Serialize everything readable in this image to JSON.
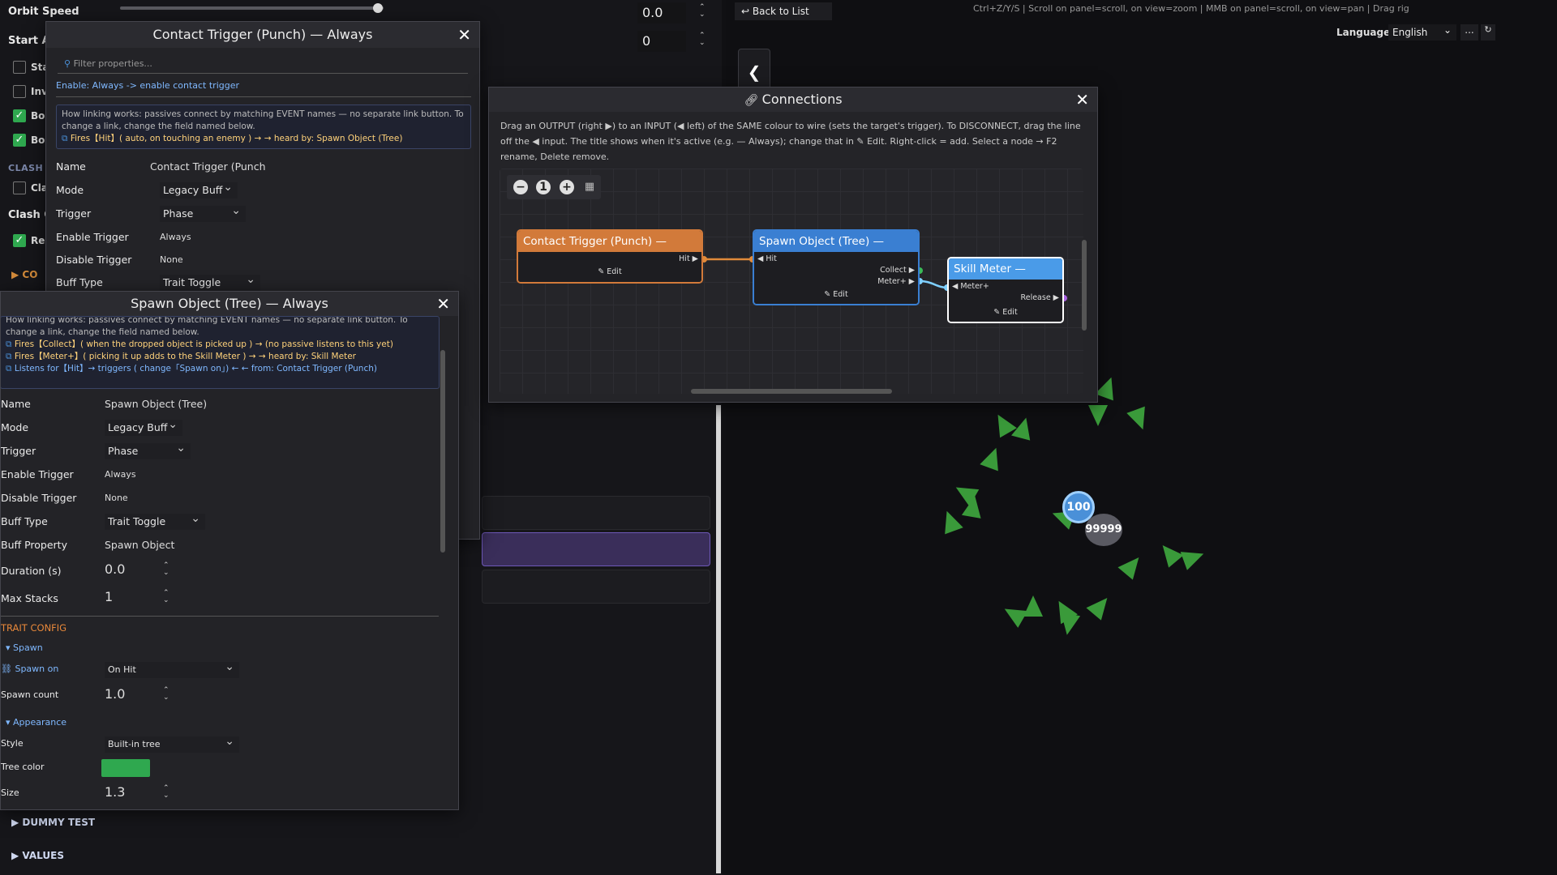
{
  "background": {
    "orbit_speed_label": "Orbit Speed",
    "orbit_speed_value": "0.0",
    "start_label": "Start A",
    "start_value": "0",
    "checkbox_labels": [
      "Sta",
      "Inv",
      "Bo",
      "Bo"
    ],
    "clash_section": "CLASH",
    "clash_checkbox_label": "Cla",
    "clash_row_label": "Clash C",
    "re_label": "Re",
    "co_section": "CO",
    "dummy_test": "DUMMY TEST",
    "values": "VALUES"
  },
  "top": {
    "back_label": "↩ Back to List",
    "hint": "Ctrl+Z/Y/S | Scroll on panel=scroll, on view=zoom | MMB on panel=scroll, on view=pan | Drag rig",
    "language_label": "Language:",
    "language_value": "English",
    "ellipsis": "...",
    "reload": "↻",
    "collapse_glyph": "❮"
  },
  "contact_panel": {
    "title": "Contact Trigger (Punch) — Always",
    "close": "✕",
    "filter_placeholder": "Filter properties...",
    "enable_note": "Enable: Always -> enable contact trigger",
    "info_text": "How linking works: passives connect by matching EVENT names — no separate link button. To change a link, change the field named below.",
    "fires_text": "Fires【Hit】( auto, on touching an enemy ) → → heard by: Spawn Object (Tree)",
    "props": {
      "name_label": "Name",
      "name_value": "Contact Trigger (Punch",
      "mode_label": "Mode",
      "mode_value": "Legacy Buff",
      "trigger_label": "Trigger",
      "trigger_value": "Phase",
      "enable_label": "Enable Trigger",
      "enable_value": "Always",
      "disable_label": "Disable Trigger",
      "disable_value": "None",
      "bufftype_label": "Buff Type",
      "bufftype_value": "Trait Toggle"
    }
  },
  "spawn_panel": {
    "title": "Spawn Object (Tree) — Always",
    "close": "✕",
    "info_text": "How linking works: passives connect by matching EVENT names — no separate link button. To change a link, change the field named below.",
    "line1": "Fires【Collect】( when the dropped object is picked up ) → (no passive listens to this yet)",
    "line2": "Fires【Meter+】( picking it up adds to the Skill Meter ) → → heard by: Skill Meter",
    "line3": "Listens for【Hit】→ triggers ( change「Spawn on」) ← ← from: Contact Trigger (Punch)",
    "props": {
      "name_label": "Name",
      "name_value": "Spawn Object (Tree)",
      "mode_label": "Mode",
      "mode_value": "Legacy Buff",
      "trigger_label": "Trigger",
      "trigger_value": "Phase",
      "enable_label": "Enable Trigger",
      "enable_value": "Always",
      "disable_label": "Disable Trigger",
      "disable_value": "None",
      "bufftype_label": "Buff Type",
      "bufftype_value": "Trait Toggle",
      "buffprop_label": "Buff Property",
      "buffprop_value": "Spawn Object",
      "duration_label": "Duration (s)",
      "duration_value": "0.0",
      "maxstacks_label": "Max Stacks",
      "maxstacks_value": "1"
    },
    "trait_config": "TRAIT CONFIG",
    "spawn_group": "▾ Spawn",
    "spawn_on_label": "Spawn on",
    "spawn_on_value": "On Hit",
    "spawn_count_label": "Spawn count",
    "spawn_count_value": "1.0",
    "appearance_group": "▾ Appearance",
    "style_label": "Style",
    "style_value": "Built-in tree",
    "tree_color_label": "Tree color",
    "size_label": "Size",
    "size_value": "1.3",
    "tree_color": "#2fa84f"
  },
  "connections": {
    "title": "Connections",
    "close": "✕",
    "help": "Drag an OUTPUT (right ▶) to an INPUT (◀ left) of the SAME colour to wire (sets the target's trigger). To DISCONNECT, drag the line off the ◀ input. The title shows when it's active (e.g. — Always); change that in ✎ Edit. Right-click = add. Select a node → F2 rename, Delete remove.",
    "zoom_controls": [
      "−",
      "1",
      "+",
      "▦"
    ],
    "nodes": [
      {
        "title": "Contact Trigger (Punch) — Always",
        "out": "Hit ▶",
        "edit": "✎ Edit",
        "color": "#d27a3a"
      },
      {
        "title": "Spawn Object (Tree) — Always",
        "in": "◀ Hit",
        "out1": "Collect ▶",
        "out2": "Meter+ ▶",
        "edit": "✎ Edit",
        "color": "#3a7fd2"
      },
      {
        "title": "Skill Meter — Always",
        "in": "◀ Meter+",
        "out": "Release ▶",
        "edit": "✎ Edit",
        "color": "#4a9be8"
      }
    ]
  },
  "game": {
    "counter_blue": "100",
    "counter_gray": "99999"
  }
}
